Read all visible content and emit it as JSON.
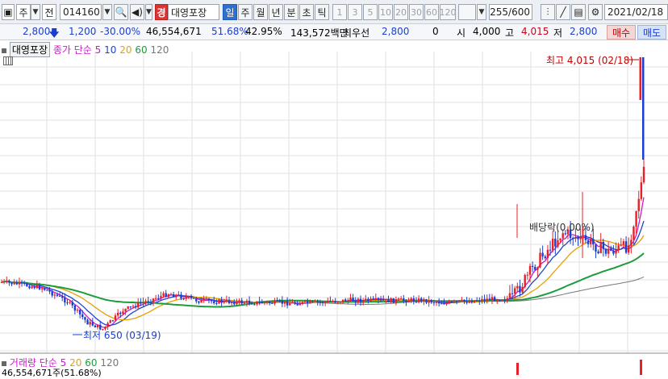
{
  "toolbar": {
    "type_select": "주",
    "market_label": "전",
    "code_value": "014160",
    "badge": "경",
    "stock_name": "대영포장",
    "periods": [
      "일",
      "주",
      "월",
      "년",
      "분",
      "초",
      "틱"
    ],
    "minutes": [
      "1",
      "3",
      "5",
      "10",
      "20",
      "30",
      "60",
      "120"
    ],
    "count": "255",
    "total": "/600",
    "date": "2021/02/18"
  },
  "quote": {
    "price": "2,800",
    "change": "1,200",
    "change_rate": "-30.00%",
    "volume": "46,554,671",
    "rate1": "51.68%",
    "rate2": "42.95%",
    "amount": "143,572백만",
    "best_label": "최우선",
    "best_value": "2,800",
    "zero": "0",
    "open_label": "시",
    "open": "4,000",
    "high_label": "고",
    "high": "4,015",
    "low_label": "저",
    "low": "2,800",
    "buy": "매수",
    "sell": "매도"
  },
  "legend": {
    "name": "대영포장",
    "ma_title": "종가 단순",
    "ma_periods": [
      "5",
      "10",
      "20",
      "60",
      "120"
    ],
    "ma_colors": [
      "#c81ec8",
      "#2244cc",
      "#e6a100",
      "#1e9c3c",
      "#777777"
    ],
    "vol_title": "거래량 단순",
    "vol_periods": [
      "5",
      "20",
      "60",
      "120"
    ],
    "vol_colors": [
      "#c81ec8",
      "#e6a100",
      "#1e9c3c",
      "#777777"
    ],
    "vol_value": "46,554,671주(51.68%)"
  },
  "chart_data": {
    "type": "candlestick",
    "annotations": {
      "high": "최고 4,015 (02/18)",
      "low": "최저 650 (03/19)",
      "dividend": "배당락(0.00%)"
    },
    "colors": {
      "up": "#e8202a",
      "down": "#1a3fd0"
    },
    "ylim": [
      500,
      4200
    ],
    "grid": true
  }
}
